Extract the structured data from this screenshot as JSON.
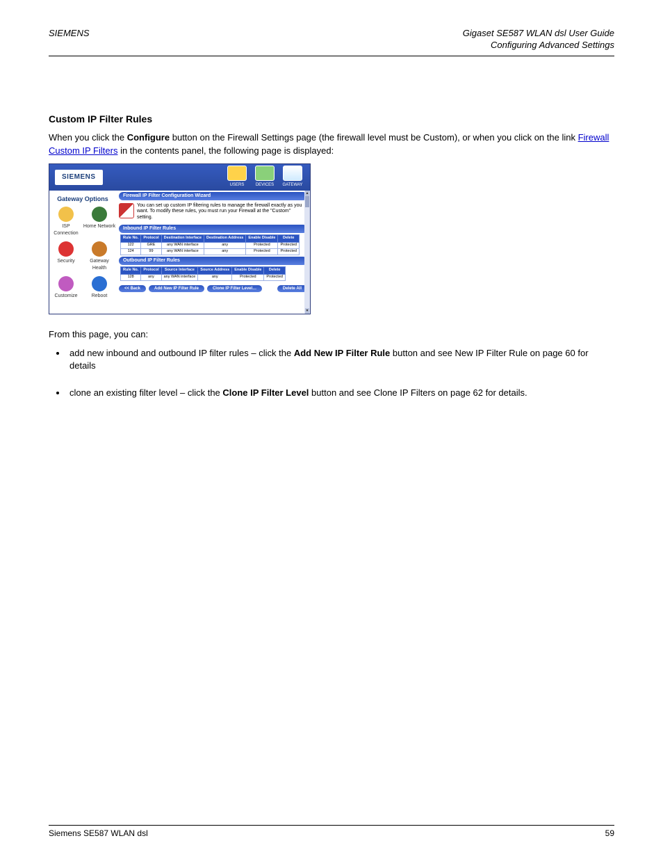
{
  "header": {
    "left": "SIEMENS",
    "right_line1": "Gigaset SE587 WLAN dsl User Guide",
    "right_line2": "Configuring Advanced Settings"
  },
  "intro": {
    "heading": "Custom IP Filter Rules",
    "para1_a": "When you click the ",
    "para1_b_bold": "Configure",
    "para1_c": " button on the Firewall Settings page (the firewall level must be Custom), or when you click on the link ",
    "para1_link": "Firewall Custom IP Filters",
    "para1_d": " in the contents panel, the following page is displayed:"
  },
  "screenshot": {
    "logo": "SIEMENS",
    "tabs": [
      {
        "label": "USERS"
      },
      {
        "label": "DEVICES"
      },
      {
        "label": "GATEWAY"
      }
    ],
    "sidebar_title": "Gateway Options",
    "sidebar_items": [
      {
        "label": "ISP Connection",
        "color": "#f2c14a"
      },
      {
        "label": "Home Network",
        "color": "#3a7a3a"
      },
      {
        "label": "Security",
        "color": "#d33"
      },
      {
        "label": "Gateway Health",
        "color": "#c97a2a"
      },
      {
        "label": "Customize",
        "color": "#c05bc0"
      },
      {
        "label": "Reboot",
        "color": "#2a6fd3"
      }
    ],
    "band_wizard": "Firewall IP Filter Configuration Wizard",
    "desc": "You can set up custom IP filtering rules to manage the firewall exactly as you want. To modify these rules, you must run your Firewall at the \"Custom\" setting.",
    "band_inbound": "Inbound IP Filter Rules",
    "inbound": {
      "headers": [
        "Rule No.",
        "Protocol",
        "Destination Interface",
        "Destination Address",
        "Enable Disable",
        "Delete"
      ],
      "rows": [
        [
          "122",
          "GRE",
          "any WAN interface",
          "any",
          "Protected",
          "Protected"
        ],
        [
          "124",
          "99",
          "any WAN interface",
          "any",
          "Protected",
          "Protected"
        ]
      ]
    },
    "band_outbound": "Outbound IP Filter Rules",
    "outbound": {
      "headers": [
        "Rule No.",
        "Protocol",
        "Source Interface",
        "Source Address",
        "Enable Disable",
        "Delete"
      ],
      "rows": [
        [
          "128",
          "any",
          "any WAN interface",
          "any",
          "Protected",
          "Protected"
        ]
      ]
    },
    "buttons": {
      "back": "<< Back",
      "add": "Add New IP Filter Rule",
      "clone": "Clone IP Filter Level…",
      "delete_all": "Delete All"
    }
  },
  "below": {
    "lead": "From this page, you can:",
    "bullets": [
      {
        "a": "add new inbound and outbound IP filter rules – click the ",
        "b_bold": "Add New IP Filter Rule",
        "c": " button and see ",
        "link": "New IP Filter Rule",
        "d": " on page 60 for details"
      },
      {
        "a": "clone an existing filter level – click the ",
        "b_bold": "Clone IP Filter Level",
        "c": " button and see ",
        "link": "Clone IP Filters",
        "d": " on page 62 for details."
      }
    ]
  },
  "footer": {
    "left": "Siemens SE587 WLAN dsl",
    "right": "59"
  }
}
